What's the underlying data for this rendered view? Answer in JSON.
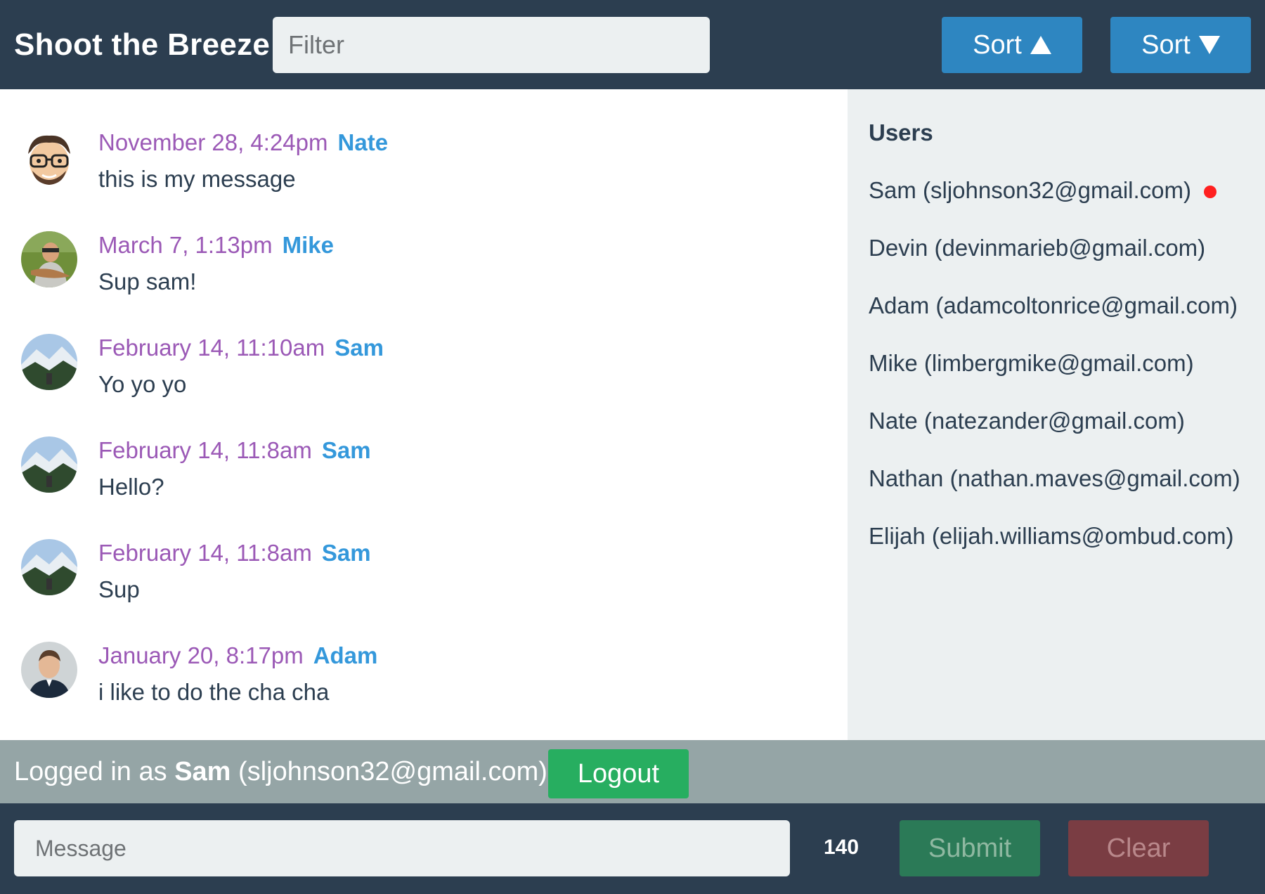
{
  "header": {
    "title": "Shoot the Breeze",
    "filter_placeholder": "Filter",
    "filter_value": "",
    "sort_asc_label": "Sort",
    "sort_desc_label": "Sort"
  },
  "messages": [
    {
      "time": "November 28, 4:24pm",
      "user": "Nate",
      "text": "this is my message",
      "avatar": "nate-avatar"
    },
    {
      "time": "March 7, 1:13pm",
      "user": "Mike",
      "text": "Sup sam!",
      "avatar": "mike-avatar"
    },
    {
      "time": "February 14, 11:10am",
      "user": "Sam",
      "text": "Yo yo yo",
      "avatar": "sam-avatar"
    },
    {
      "time": "February 14, 11:8am",
      "user": "Sam",
      "text": "Hello?",
      "avatar": "sam-avatar"
    },
    {
      "time": "February 14, 11:8am",
      "user": "Sam",
      "text": "Sup",
      "avatar": "sam-avatar"
    },
    {
      "time": "January 20, 8:17pm",
      "user": "Adam",
      "text": "i like to do the cha cha",
      "avatar": "adam-avatar"
    }
  ],
  "users": {
    "heading": "Users",
    "items": [
      {
        "label": "Sam (sljohnson32@gmail.com)",
        "online": true
      },
      {
        "label": "Devin (devinmarieb@gmail.com)",
        "online": false
      },
      {
        "label": "Adam (adamcoltonrice@gmail.com)",
        "online": false
      },
      {
        "label": "Mike (limbergmike@gmail.com)",
        "online": false
      },
      {
        "label": "Nate (natezander@gmail.com)",
        "online": false
      },
      {
        "label": "Nathan (nathan.maves@gmail.com)",
        "online": false
      },
      {
        "label": "Elijah (elijah.williams@ombud.com)",
        "online": false
      }
    ]
  },
  "login": {
    "prefix": "Logged in as",
    "name": "Sam",
    "email": "(sljohnson32@gmail.com)",
    "logout_label": "Logout"
  },
  "composer": {
    "placeholder": "Message",
    "value": "",
    "char_count": "140",
    "submit_label": "Submit",
    "clear_label": "Clear"
  },
  "colors": {
    "header_bg": "#2c3e50",
    "timestamp": "#9b59b6",
    "username": "#3498db",
    "sidebar_bg": "#ecf0f1",
    "login_bar_bg": "#95a5a6",
    "logout_bg": "#27ae60",
    "sort_bg": "#2e86c1",
    "online_dot": "#ff2020"
  }
}
